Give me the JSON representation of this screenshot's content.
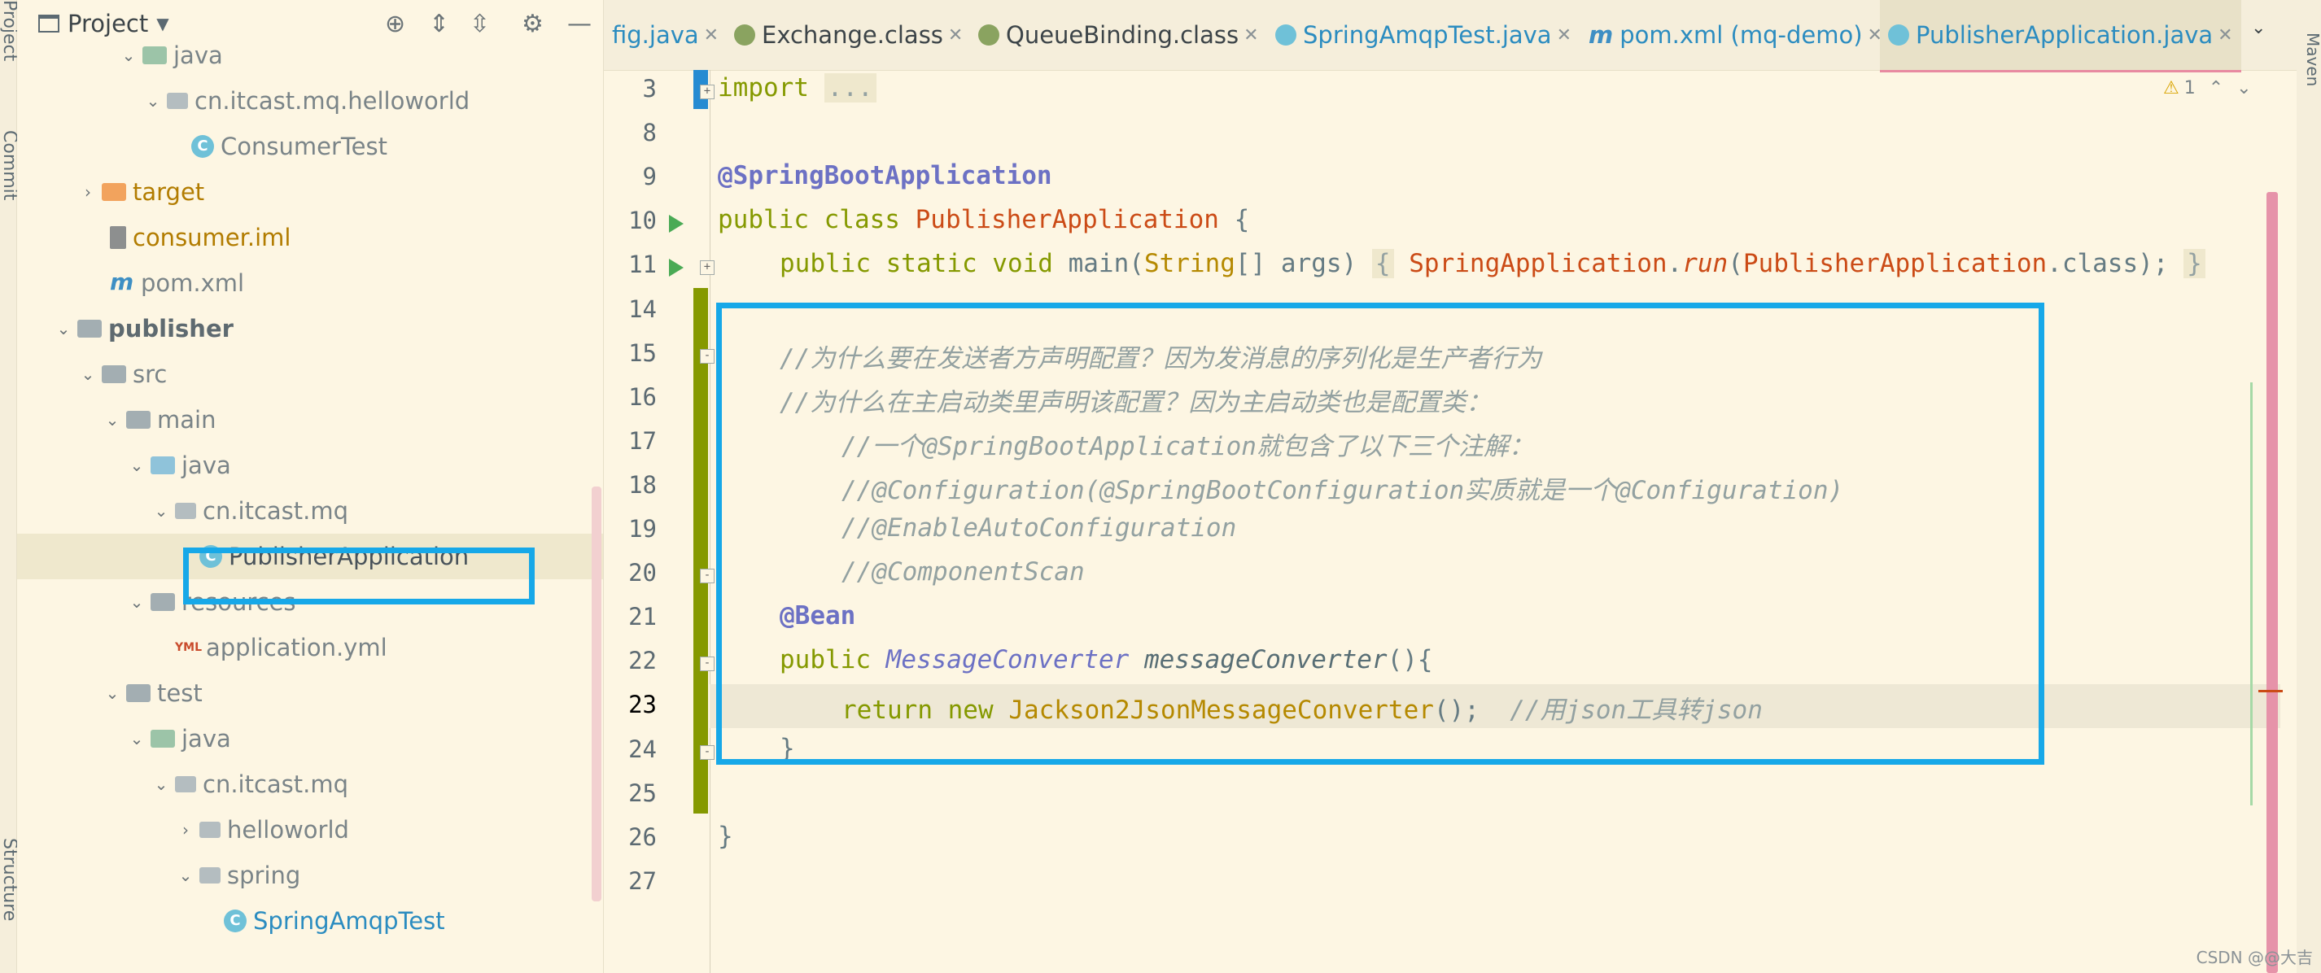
{
  "sidebar_tabs": {
    "project": "Project",
    "commit": "Commit",
    "structure": "Structure"
  },
  "project_panel": {
    "title": "Project",
    "tree": [
      {
        "label": "java",
        "icon": "folder-src",
        "chev": "v"
      },
      {
        "label": "cn.itcast.mq.helloworld",
        "icon": "pkg",
        "chev": "v"
      },
      {
        "label": "ConsumerTest",
        "icon": "cls",
        "chev": ""
      },
      {
        "label": "target",
        "icon": "folder-orange",
        "chev": ">"
      },
      {
        "label": "consumer.iml",
        "icon": "iml",
        "chev": ""
      },
      {
        "label": "pom.xml",
        "icon": "mvn",
        "chev": ""
      },
      {
        "label": "publisher",
        "icon": "folder-grey",
        "chev": "v"
      },
      {
        "label": "src",
        "icon": "folder-grey",
        "chev": "v"
      },
      {
        "label": "main",
        "icon": "folder-grey",
        "chev": "v"
      },
      {
        "label": "java",
        "icon": "folder-blue",
        "chev": "v"
      },
      {
        "label": "cn.itcast.mq",
        "icon": "pkg",
        "chev": "v"
      },
      {
        "label": "PublisherApplication",
        "icon": "cls",
        "chev": ""
      },
      {
        "label": "resources",
        "icon": "res",
        "chev": "v"
      },
      {
        "label": "application.yml",
        "icon": "yml",
        "chev": ""
      },
      {
        "label": "test",
        "icon": "folder-grey",
        "chev": "v"
      },
      {
        "label": "java",
        "icon": "folder-src",
        "chev": "v"
      },
      {
        "label": "cn.itcast.mq",
        "icon": "pkg",
        "chev": "v"
      },
      {
        "label": "helloworld",
        "icon": "pkg",
        "chev": ">"
      },
      {
        "label": "spring",
        "icon": "pkg",
        "chev": "v"
      },
      {
        "label": "SpringAmqpTest",
        "icon": "cls",
        "chev": ""
      }
    ]
  },
  "tabs": [
    {
      "label": "fig.java"
    },
    {
      "label": "Exchange.class"
    },
    {
      "label": "QueueBinding.class"
    },
    {
      "label": "SpringAmqpTest.java"
    },
    {
      "label": "pom.xml (mq-demo)"
    },
    {
      "label": "PublisherApplication.java"
    }
  ],
  "editor": {
    "line_numbers": [
      "3",
      "8",
      "9",
      "10",
      "11",
      "14",
      "15",
      "16",
      "17",
      "18",
      "19",
      "20",
      "21",
      "22",
      "23",
      "24",
      "25",
      "26",
      "27"
    ],
    "current_line": "23",
    "warning_count": "1",
    "maven_label": "Maven",
    "code": {
      "l3_kw": "import",
      "l3_fold": "...",
      "l9_ann": "@SpringBootApplication",
      "l10_kw": "public class ",
      "l10_cls": "PublisherApplication",
      "l10_brace": " {",
      "l11_kw": "public static void ",
      "l11_main": "main(",
      "l11_type": "String",
      "l11_args": "[] args)",
      "l11_fold": "{",
      "l11_sa": "SpringApplication",
      "l11_dot": ".",
      "l11_run": "run",
      "l11_paren": "(",
      "l11_pa": "PublisherApplication",
      "l11_tail": ".class);",
      "l11_fold_end": "}",
      "l15": "//为什么要在发送者方声明配置？因为发消息的序列化是生产者行为",
      "l16": "//为什么在主启动类里声明该配置？因为主启动类也是配置类：",
      "l17": "//一个@SpringBootApplication就包含了以下三个注解：",
      "l18": "//@Configuration(@SpringBootConfiguration实质就是一个@Configuration)",
      "l19": "//@EnableAutoConfiguration",
      "l20": "//@ComponentScan",
      "l21": "@Bean",
      "l22_kw": "public ",
      "l22_type": "MessageConverter",
      "l22_meth": " messageConverter",
      "l22_tail": "(){",
      "l23_kw": "return new ",
      "l23_type": "Jackson2JsonMessageConverter",
      "l23_tail": "();  ",
      "l23_cmt": "//用json工具转json",
      "l24": "}",
      "l26": "}"
    }
  },
  "watermark": "CSDN @@大吉",
  "colors": {
    "highlight": "#17a8e8",
    "change_bar": "#859900",
    "background": "#fdf6e3"
  }
}
